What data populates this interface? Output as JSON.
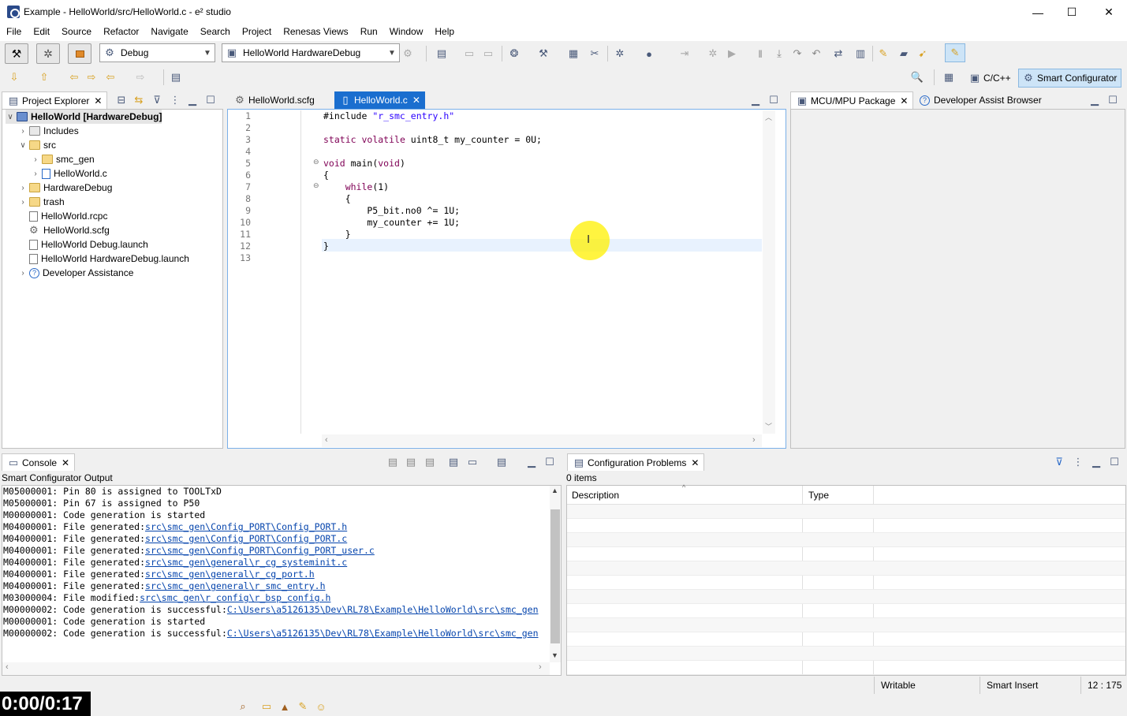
{
  "window": {
    "title": "Example - HelloWorld/src/HelloWorld.c - e² studio",
    "minimize": "—",
    "maximize": "☐",
    "close": "✕"
  },
  "menu": [
    "File",
    "Edit",
    "Source",
    "Refactor",
    "Navigate",
    "Search",
    "Project",
    "Renesas Views",
    "Run",
    "Window",
    "Help"
  ],
  "toolbar": {
    "build_config": "Debug",
    "launch_config": "HelloWorld HardwareDebug",
    "perspective_cpp": "C/C++",
    "perspective_smart": "Smart Configurator"
  },
  "project_explorer": {
    "tab": "Project Explorer",
    "items": [
      {
        "label": "HelloWorld [HardwareDebug]"
      },
      {
        "label": "Includes"
      },
      {
        "label": "src"
      },
      {
        "label": "smc_gen"
      },
      {
        "label": "HelloWorld.c"
      },
      {
        "label": "HardwareDebug"
      },
      {
        "label": "trash"
      },
      {
        "label": "HelloWorld.rcpc"
      },
      {
        "label": "HelloWorld.scfg"
      },
      {
        "label": "HelloWorld Debug.launch"
      },
      {
        "label": "HelloWorld HardwareDebug.launch"
      },
      {
        "label": "Developer Assistance"
      }
    ]
  },
  "editor": {
    "tabs": [
      "HelloWorld.scfg",
      "HelloWorld.c"
    ],
    "line_numbers": [
      "1",
      "2",
      "3",
      "4",
      "5",
      "6",
      "7",
      "8",
      "9",
      "10",
      "11",
      "12",
      "13"
    ],
    "lines": [
      "#include \"r_smc_entry.h\"",
      "",
      "static volatile uint8_t my_counter = 0U;",
      "",
      "void main(void)",
      "{",
      "    while(1)",
      "    {",
      "        P5_bit.no0 ^= 1U;",
      "        my_counter += 1U;",
      "    }",
      "}",
      ""
    ]
  },
  "right_panel": {
    "tabs": [
      "MCU/MPU Package",
      "Developer Assist Browser"
    ]
  },
  "console": {
    "tab": "Console",
    "header": "Smart Configurator Output",
    "lines": [
      {
        "text": "M05000001: Pin 80 is assigned to TOOLTxD",
        "link": ""
      },
      {
        "text": "M05000001: Pin 67 is assigned to P50",
        "link": ""
      },
      {
        "text": "M00000001: Code generation is started",
        "link": ""
      },
      {
        "text": "M04000001: File generated:",
        "link": "src\\smc_gen\\Config_PORT\\Config_PORT.h"
      },
      {
        "text": "M04000001: File generated:",
        "link": "src\\smc_gen\\Config_PORT\\Config_PORT.c"
      },
      {
        "text": "M04000001: File generated:",
        "link": "src\\smc_gen\\Config_PORT\\Config_PORT_user.c"
      },
      {
        "text": "M04000001: File generated:",
        "link": "src\\smc_gen\\general\\r_cg_systeminit.c"
      },
      {
        "text": "M04000001: File generated:",
        "link": "src\\smc_gen\\general\\r_cg_port.h"
      },
      {
        "text": "M04000001: File generated:",
        "link": "src\\smc_gen\\general\\r_smc_entry.h"
      },
      {
        "text": "M03000004: File modified:",
        "link": "src\\smc_gen\\r_config\\r_bsp_config.h"
      },
      {
        "text": "M00000002: Code generation is successful:",
        "link": "C:\\Users\\a5126135\\Dev\\RL78\\Example\\HelloWorld\\src\\smc_gen"
      },
      {
        "text": "M00000001: Code generation is started",
        "link": ""
      },
      {
        "text": "M00000002: Code generation is successful:",
        "link": "C:\\Users\\a5126135\\Dev\\RL78\\Example\\HelloWorld\\src\\smc_gen"
      }
    ]
  },
  "config_problems": {
    "tab": "Configuration Problems",
    "count": "0 items",
    "col_description": "Description",
    "col_type": "Type"
  },
  "status": {
    "writable": "Writable",
    "insert_mode": "Smart Insert",
    "position": "12 : 175"
  },
  "video_timer": "0:00/0:17"
}
